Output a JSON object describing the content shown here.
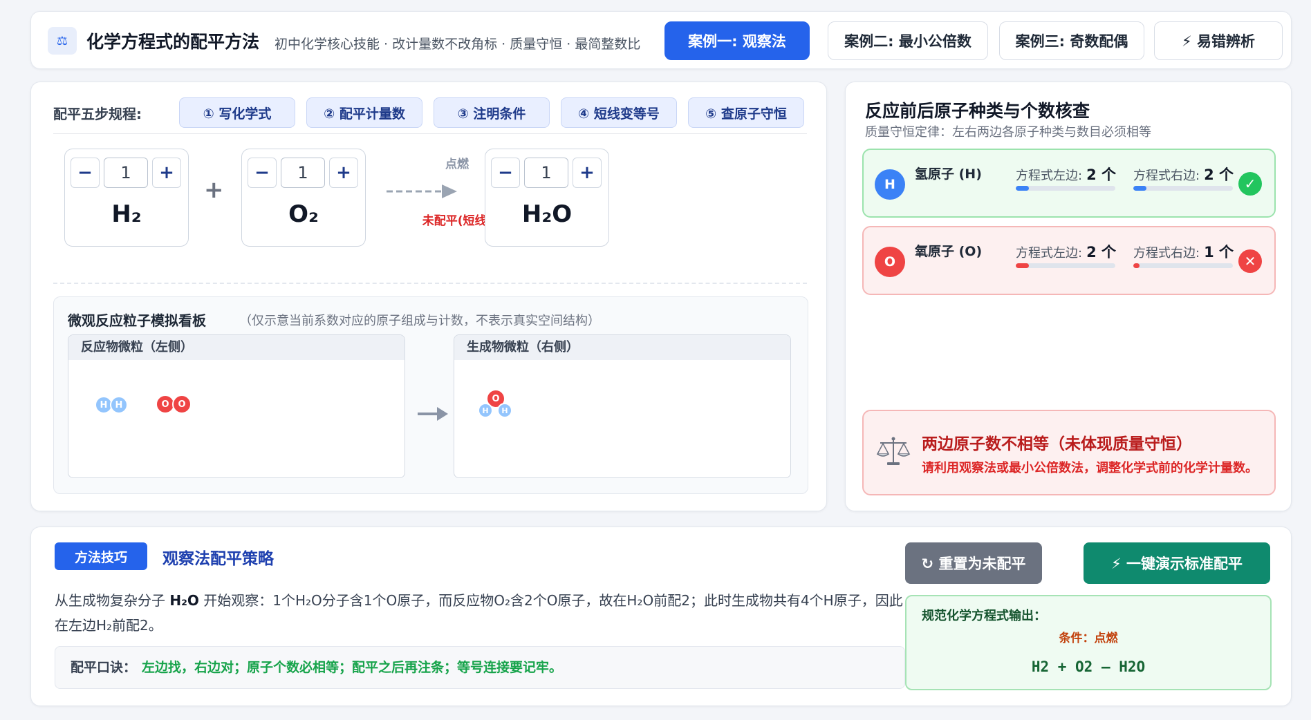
{
  "header": {
    "logo_glyph": "⚖",
    "title": "化学方程式的配平方法",
    "subtitle": "初中化学核心技能 · 改计量数不改角标 · 质量守恒 · 最简整数比",
    "tabs": [
      "案例一: 观察法",
      "案例二: 最小公倍数",
      "案例三: 奇数配偶",
      "⚡ 易错辨析"
    ],
    "active_tab": 0
  },
  "steps": {
    "label": "配平五步规程:",
    "items": [
      "① 写化学式",
      "② 配平计量数",
      "③ 注明条件",
      "④ 短线变等号",
      "⑤ 查原子守恒"
    ]
  },
  "equation": {
    "minus": "−",
    "plus_btn": "+",
    "plus_sign": "+",
    "reactants": [
      {
        "formula": "H₂",
        "coefficient": "1"
      },
      {
        "formula": "O₂",
        "coefficient": "1"
      }
    ],
    "condition": "点燃",
    "status": "未配平(短线)",
    "products": [
      {
        "formula": "H₂O",
        "coefficient": "1"
      }
    ]
  },
  "micro": {
    "title": "微观反应粒子模拟看板",
    "subtitle": "（仅示意当前系数对应的原子组成与计数，不表示真实空间结构）",
    "left_title": "反应物微粒（左侧）",
    "right_title": "生成物微粒（右侧）",
    "atom_h": "H",
    "atom_o": "O"
  },
  "check": {
    "title": "反应前后原子种类与个数核查",
    "subtitle": "质量守恒定律：左右两边各原子种类与数目必须相等",
    "atoms": [
      {
        "symbol": "H",
        "name": "氢原子 (H)",
        "left_label": "方程式左边:",
        "left": "2 个",
        "right_label": "方程式右边:",
        "right": "2 个",
        "left_ratio": 0.13,
        "right_ratio": 0.13,
        "balanced": true,
        "color": "#3b82f6",
        "icon": "✓"
      },
      {
        "symbol": "O",
        "name": "氧原子 (O)",
        "left_label": "方程式左边:",
        "left": "2 个",
        "right_label": "方程式右边:",
        "right": "1 个",
        "left_ratio": 0.13,
        "right_ratio": 0.06,
        "balanced": false,
        "color": "#ef4444",
        "icon": "✕"
      }
    ],
    "warning_title": "两边原子数不相等（未体现质量守恒）",
    "warning_body": "请利用观察法或最小公倍数法，调整化学式前的化学计量数。"
  },
  "tip": {
    "badge": "方法技巧",
    "title": "观察法配平策略",
    "body_lead": "从生成物复杂分子 ",
    "body_bold": "H₂O",
    "body_rest": " 开始观察：1个H₂O分子含1个O原子，而反应物O₂含2个O原子，故在H₂O前配2；此时生成物共有4个H原子，因此在左边H₂前配2。",
    "mnemonic_label": "配平口诀：",
    "mnemonic": "左边找，右边对；原子个数必相等；配平之后再注条；等号连接要记牢。"
  },
  "actions": {
    "reset": "↻ 重置为未配平",
    "demo": "⚡ 一键演示标准配平"
  },
  "output": {
    "title": "规范化学方程式输出：",
    "condition": "条件：点燃",
    "equation": "H2 + O2 — H2O"
  },
  "colors": {
    "accent": "#2563eb",
    "ok": "#22c55e",
    "bad": "#ef4444",
    "reset_btn": "#6b7280",
    "demo_btn": "#0f8a6e"
  }
}
